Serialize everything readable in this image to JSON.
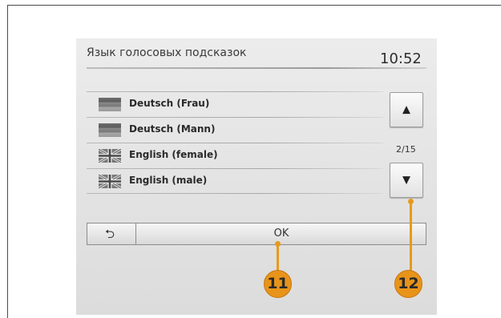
{
  "header": {
    "title": "Язык голосовых подсказок",
    "time": "10:52"
  },
  "voices": [
    {
      "label": "Deutsch (Frau)",
      "flag": "de-flag-icon"
    },
    {
      "label": "Deutsch (Mann)",
      "flag": "de-flag-icon"
    },
    {
      "label": "English (female)",
      "flag": "uk-flag-icon"
    },
    {
      "label": "English (male)",
      "flag": "uk-flag-icon"
    }
  ],
  "scroll": {
    "up_icon": "▲",
    "down_icon": "▼",
    "page_indicator": "2/15"
  },
  "bottom_bar": {
    "back_icon": "⮌",
    "ok_label": "OK"
  },
  "callouts": {
    "ok": "11",
    "scroll_down": "12",
    "color": "#e8931a"
  }
}
